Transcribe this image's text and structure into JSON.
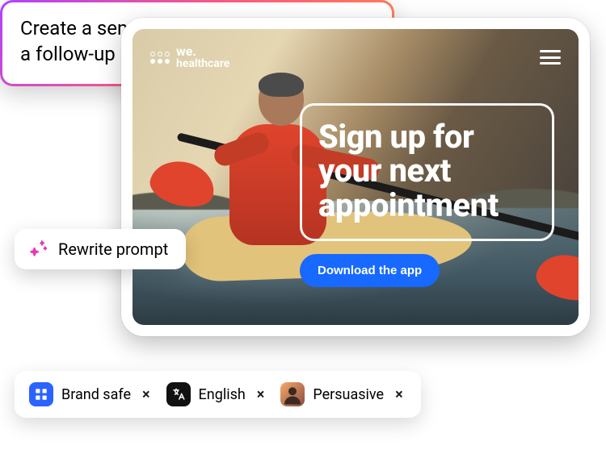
{
  "brand": {
    "line1": "we.",
    "line2": "healthcare"
  },
  "hero": {
    "headline": "Sign up for your next appointment",
    "cta_label": "Download the app"
  },
  "rewrite": {
    "label": "Rewrite prompt"
  },
  "prompt": {
    "text": "Create a sense of urgency to sign up for a follow-up appointment"
  },
  "chips": [
    {
      "label": "Brand safe",
      "icon": "grid"
    },
    {
      "label": "English",
      "icon": "lang"
    },
    {
      "label": "Persuasive",
      "icon": "pers"
    }
  ],
  "colors": {
    "cta": "#1769ff",
    "gradient": [
      "#b041ff",
      "#ff5b7a",
      "#ff8a4c"
    ]
  }
}
